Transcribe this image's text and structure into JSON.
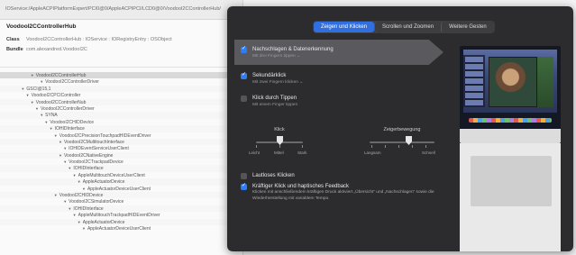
{
  "explorer": {
    "path": "IOService:/AppleACPIPlatformExpert/PCI0@0/AppleACPIPCI/LCD0@0/VoodooI2CControllerHub/",
    "object_title": "VoodooI2CControllerHub",
    "props": [
      {
        "key": "Class",
        "value": "VoodooI2CControllerHub : IOService : IORegistryEntry : OSObject"
      },
      {
        "key": "Bundle",
        "value": "com.alexandred.VoodooI2C"
      }
    ],
    "tree": [
      {
        "indent": 13,
        "label": "VoodooI2CControllerHub",
        "sel": true
      },
      {
        "indent": 17,
        "label": "VoodooI2CControllerDriver"
      },
      {
        "indent": 9,
        "label": "GSCI@15,1"
      },
      {
        "indent": 11,
        "label": "VoodooI2CPCIController"
      },
      {
        "indent": 13,
        "label": "VoodooI2CControllerNub"
      },
      {
        "indent": 15,
        "label": "VoodooI2CControllerDriver"
      },
      {
        "indent": 17,
        "label": "SYNA"
      },
      {
        "indent": 19,
        "label": "VoodooI2CHIDDevice"
      },
      {
        "indent": 21,
        "label": "IOHIDInterface"
      },
      {
        "indent": 23,
        "label": "VoodooI2CPrecisionTouchpadHIDEventDriver"
      },
      {
        "indent": 25,
        "label": "VoodooI2CMultitouchInterface"
      },
      {
        "indent": 27,
        "label": "IOHIDEventServiceUserClient"
      },
      {
        "indent": 25,
        "label": "VoodooI2CNativeEngine"
      },
      {
        "indent": 27,
        "label": "VoodooI2CTrackpadDevice"
      },
      {
        "indent": 29,
        "label": "IOHIDInterface"
      },
      {
        "indent": 31,
        "label": "AppleMultitouchDeviceUserClient"
      },
      {
        "indent": 33,
        "label": "AppleActuatorDevice"
      },
      {
        "indent": 35,
        "label": "AppleActuatorDeviceUserClient"
      },
      {
        "indent": 23,
        "label": "VoodooI2CHIDDevice"
      },
      {
        "indent": 27,
        "label": "VoodooI2CSimulatorDevice"
      },
      {
        "indent": 29,
        "label": "IOHIDInterface"
      },
      {
        "indent": 31,
        "label": "AppleMultitouchTrackpadHIDEventDriver"
      },
      {
        "indent": 33,
        "label": "AppleActuatorDevice"
      },
      {
        "indent": 35,
        "label": "AppleActuatorDeviceUserClient"
      }
    ]
  },
  "trackpad": {
    "tabs": [
      {
        "label": "Zeigen und Klicken",
        "active": true
      },
      {
        "label": "Scrollen und Zoomen",
        "active": false
      },
      {
        "label": "Weitere Gesten",
        "active": false
      }
    ],
    "options": {
      "lookup": {
        "title": "Nachschlagen & Datenerkennung",
        "sub": "Mit drei Fingern tippen ⌄",
        "checked": true
      },
      "secondary": {
        "title": "Sekundärklick",
        "sub": "Mit zwei Fingern klicken ⌄",
        "checked": true
      },
      "tap": {
        "title": "Klick durch Tippen",
        "sub": "Mit einem Finger tippen",
        "checked": false
      },
      "silent": {
        "title": "Lautloses Klicken",
        "checked": false
      },
      "force": {
        "title": "Kräftiger Klick und haptisches Feedback",
        "desc": "Klicken mit anschließendem kräftigen Druck aktiviert „Übersicht“ und „Nachschlagen“ sowie die Wiederherstellung mit variablem Tempo.",
        "checked": true
      }
    },
    "click_slider": {
      "label": "Klick",
      "caps": [
        "Leicht",
        "Mittel",
        "Stark"
      ],
      "level": 0.5
    },
    "speed_slider": {
      "label": "Zeigerbewegung",
      "caps": [
        "Langsam",
        "Schnell"
      ],
      "level": 0.6
    }
  }
}
